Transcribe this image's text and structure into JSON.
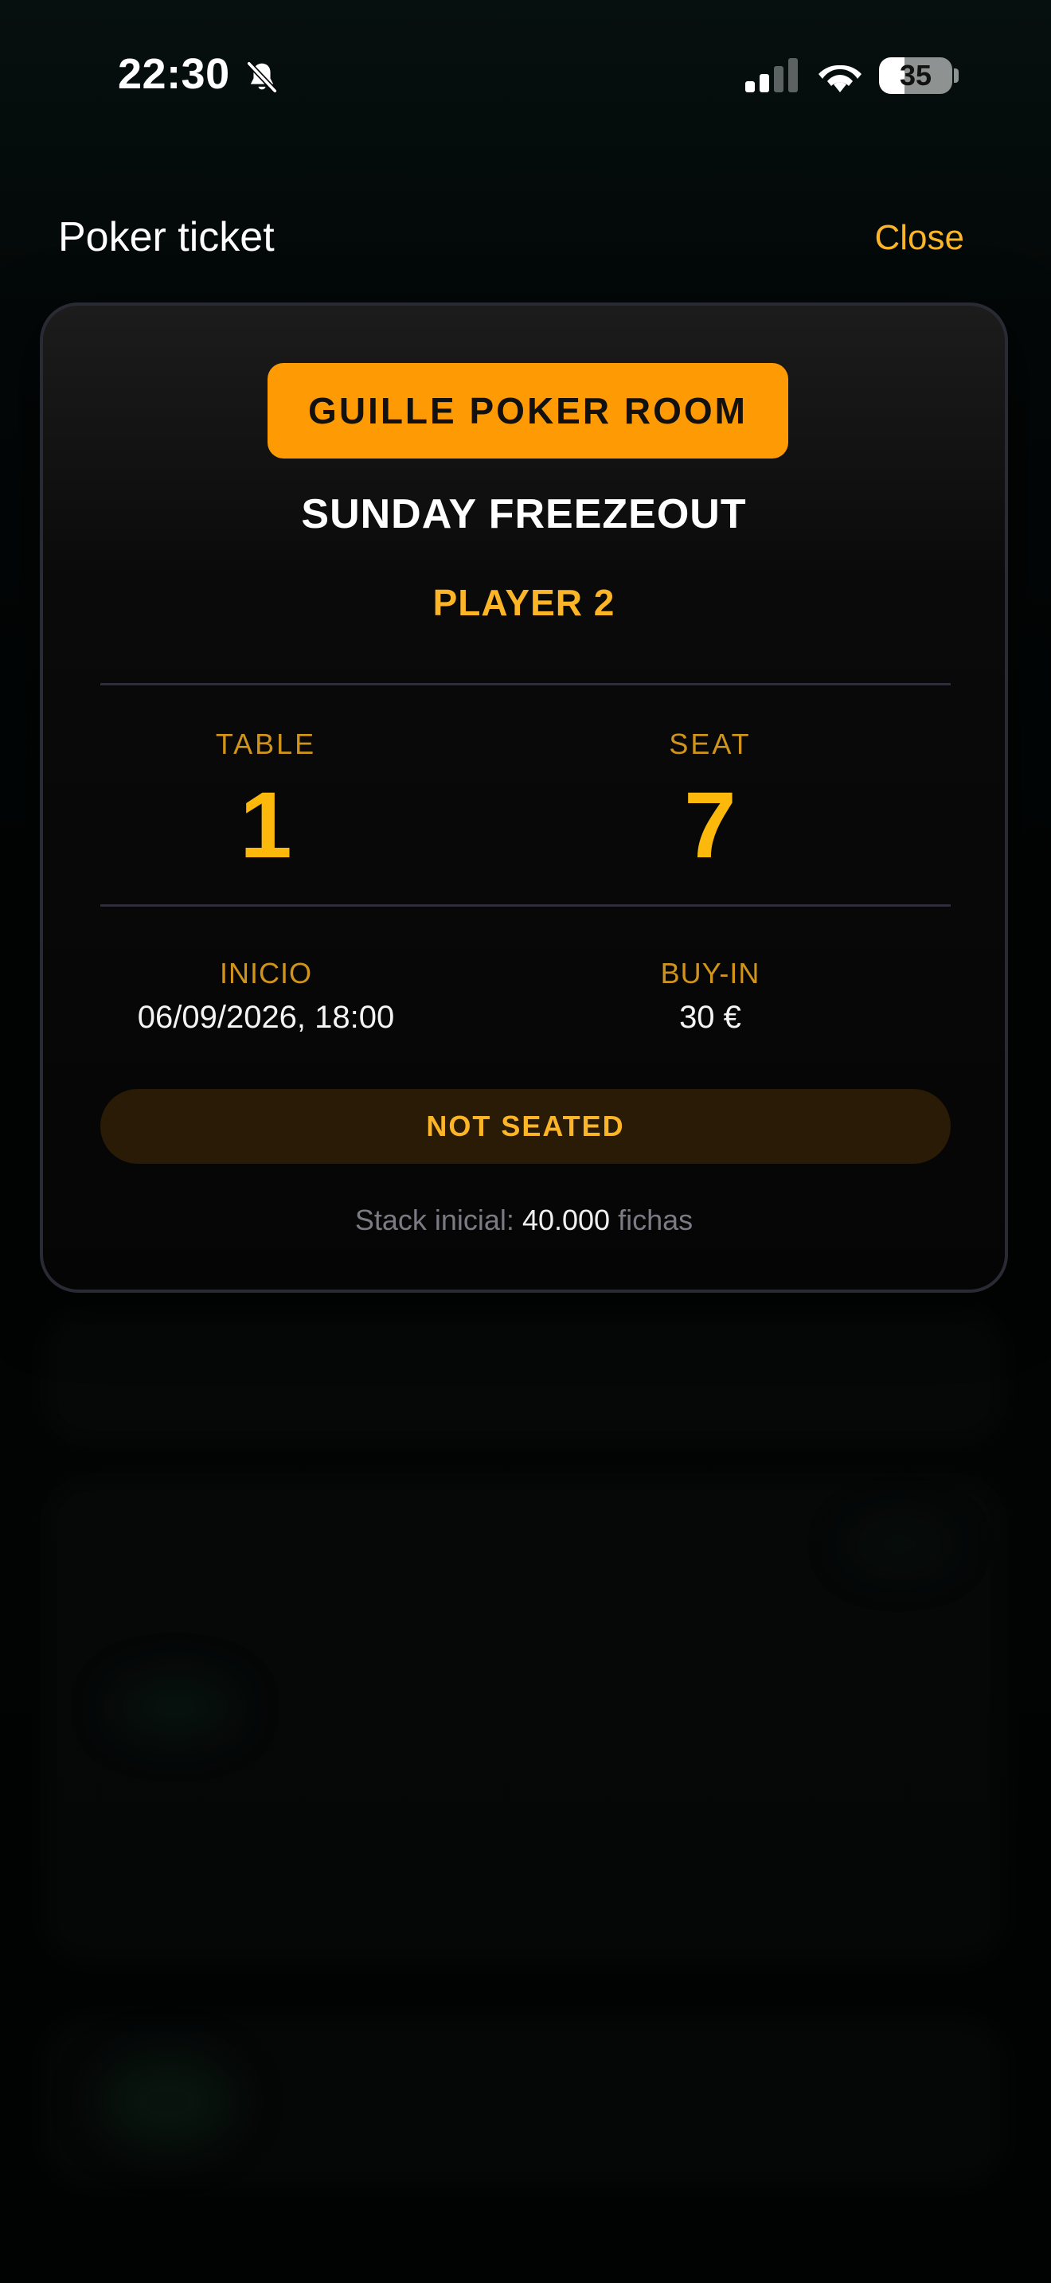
{
  "status_bar": {
    "time": "22:30",
    "battery_level": "35",
    "battery_fraction": 0.35,
    "icons": [
      "bell-slash-icon",
      "cellular-signal-icon",
      "wifi-icon",
      "battery-icon"
    ]
  },
  "header": {
    "title": "Poker ticket",
    "close_label": "Close"
  },
  "ticket": {
    "venue": "GUILLE POKER ROOM",
    "event": "SUNDAY FREEZEOUT",
    "player": "PLAYER 2",
    "table_label": "TABLE",
    "table_value": "1",
    "seat_label": "SEAT",
    "seat_value": "7",
    "start_label": "INICIO",
    "start_value": "06/09/2026, 18:00",
    "buyin_label": "BUY-IN",
    "buyin_value": "30 €",
    "status": "NOT SEATED",
    "stack_prefix": "Stack inicial:",
    "stack_value": "40.000",
    "stack_suffix": "fichas"
  },
  "colors": {
    "accent": "#fbb526",
    "badge_background": "#fe9a03",
    "status_pill_background": "#2a1b06",
    "background": "#020405"
  }
}
